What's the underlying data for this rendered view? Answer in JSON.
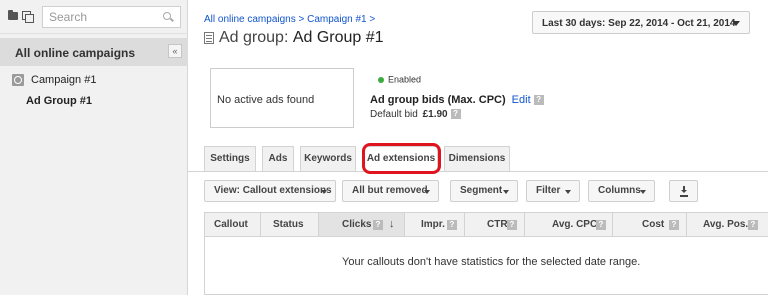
{
  "sidebar": {
    "search_placeholder": "Search",
    "all_campaigns_label": "All online campaigns",
    "collapse_label": "«",
    "campaign_label": "Campaign #1",
    "adgroup_label": "Ad Group #1"
  },
  "header": {
    "breadcrumb_all": "All online campaigns",
    "breadcrumb_sep1": " > ",
    "breadcrumb_campaign": "Campaign #1",
    "breadcrumb_sep2": " >",
    "title_prefix": "Ad group: ",
    "title_name": "Ad Group #1",
    "date_range": "Last 30 days: Sep 22, 2014 - Oct 21, 2014"
  },
  "summary": {
    "ads_box_text": "No active ads found",
    "status": "Enabled",
    "bid_title": "Ad group bids (Max. CPC)",
    "edit_label": "Edit",
    "help_label": "?",
    "default_bid_label": "Default bid",
    "default_bid_value": "£1.90"
  },
  "tabs": [
    {
      "label": "Settings"
    },
    {
      "label": "Ads"
    },
    {
      "label": "Keywords"
    },
    {
      "label": "Ad extensions",
      "active": true
    },
    {
      "label": "Dimensions"
    }
  ],
  "toolbar": {
    "view_label": "View: Callout extensions",
    "filter_status_label": "All but removed",
    "segment_label": "Segment",
    "filter_label": "Filter",
    "columns_label": "Columns"
  },
  "table": {
    "columns": [
      "Callout",
      "Status",
      "Clicks",
      "Impr.",
      "CTR",
      "Avg. CPC",
      "Cost",
      "Avg. Pos."
    ],
    "sort_indicator": "↓",
    "empty_message": "Your callouts don't have statistics for the selected date range."
  },
  "colors": {
    "link": "#1155cc",
    "status_enabled": "#3cab3c",
    "highlight": "#e0141e"
  }
}
